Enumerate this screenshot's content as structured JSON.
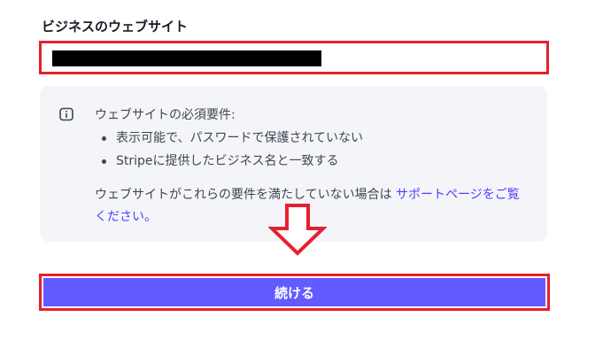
{
  "website_field": {
    "label": "ビジネスのウェブサイト",
    "value_redacted": true
  },
  "info_box": {
    "icon": "info-icon",
    "heading": "ウェブサイトの必須要件:",
    "requirements": [
      "表示可能で、パスワードで保護されていない",
      "Stripeに提供したビジネス名と一致する"
    ],
    "note_text": "ウェブサイトがこれらの要件を満たしていない場合は",
    "support_link": "サポートページをご覧ください。"
  },
  "annotation": {
    "arrow": "down-arrow-icon",
    "highlight_color": "#e5202e"
  },
  "continue_button": {
    "label": "続ける",
    "color": "#635bff"
  }
}
